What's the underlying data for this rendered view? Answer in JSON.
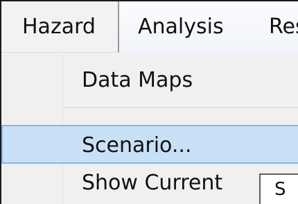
{
  "menu_bar": {
    "items": [
      {
        "label": "Hazard",
        "active": true
      },
      {
        "label": "Analysis",
        "active": false
      },
      {
        "label": "Res",
        "active": false
      }
    ]
  },
  "dropdown": {
    "items": [
      {
        "label": "Data Maps",
        "highlighted": false
      },
      {
        "label": "Scenario...",
        "highlighted": true
      },
      {
        "label": "Show Current",
        "highlighted": false
      }
    ]
  },
  "partial_control": {
    "label": "S"
  },
  "colors": {
    "highlight_fill": "#c8e1f7",
    "highlight_border": "#84b8e6",
    "menu_background": "#f0f0f0",
    "text": "#111111"
  }
}
